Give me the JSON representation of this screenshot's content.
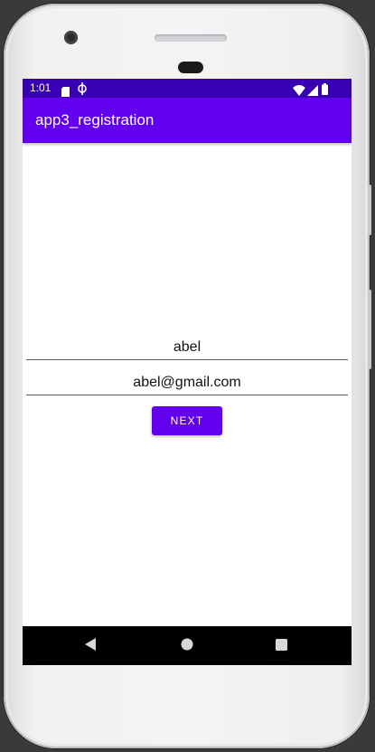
{
  "status_bar": {
    "time": "1:01",
    "icons": [
      "sd-card-icon",
      "data-saver-icon",
      "wifi-icon",
      "signal-icon",
      "battery-icon"
    ]
  },
  "app_bar": {
    "title": "app3_registration"
  },
  "form": {
    "name_value": "abel",
    "email_value": "abel@gmail.com",
    "next_label": "NEXT"
  },
  "nav_bar": {
    "icons": [
      "back-icon",
      "home-icon",
      "recents-icon"
    ]
  },
  "colors": {
    "status_bar": "#3700b3",
    "primary": "#6200ee",
    "nav_bar": "#000000",
    "background": "#ffffff"
  }
}
